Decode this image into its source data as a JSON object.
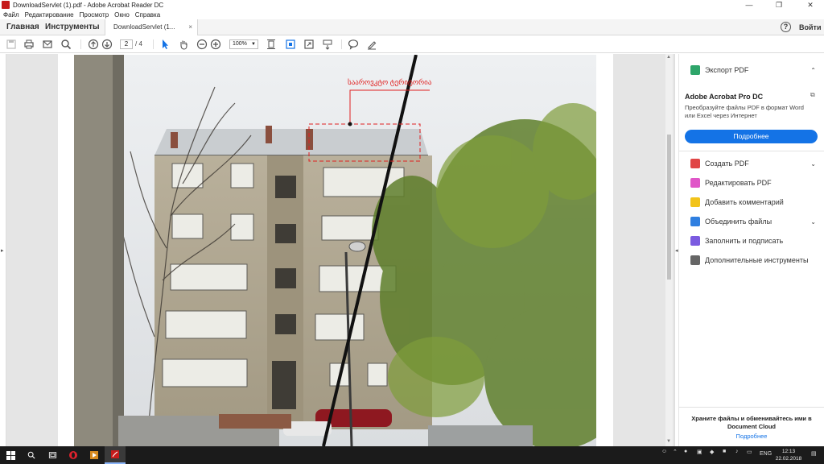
{
  "window": {
    "title": "DownloadServlet (1).pdf - Adobe Acrobat Reader DC",
    "minimize": "—",
    "maximize": "❐",
    "close": "✕"
  },
  "menu": [
    "Файл",
    "Редактирование",
    "Просмотр",
    "Окно",
    "Справка"
  ],
  "tabs": {
    "home": "Главная",
    "tools": "Инструменты",
    "document": "DownloadServlet (1...",
    "close": "×",
    "help": "?",
    "signin": "Войти"
  },
  "toolbar": {
    "page_current": "2",
    "page_total": "/  4",
    "zoom": "100%"
  },
  "document": {
    "annotation_label": "სააროვკტო ტერიტორია"
  },
  "pane": {
    "export_pdf": "Экспорт PDF",
    "promo_title": "Adobe Acrobat Pro DC",
    "promo_text": "Преобразуйте файлы PDF в формат Word или Excel через Интернет",
    "promo_button": "Подробнее",
    "tools": [
      {
        "label": "Создать PDF",
        "color": "#e04545",
        "expand": "⌄"
      },
      {
        "label": "Редактировать PDF",
        "color": "#e056c8",
        "expand": ""
      },
      {
        "label": "Добавить комментарий",
        "color": "#f2c31a",
        "expand": ""
      },
      {
        "label": "Объединить файлы",
        "color": "#2f7fe0",
        "expand": "⌄"
      },
      {
        "label": "Заполнить и подписать",
        "color": "#7b5be0",
        "expand": ""
      },
      {
        "label": "Дополнительные инструменты",
        "color": "#666666",
        "expand": ""
      }
    ],
    "cloud_text": "Храните файлы и обменивайтесь ими в Document Cloud",
    "cloud_link": "Подробнее"
  },
  "taskbar": {
    "lang": "ENG",
    "time": "12:13",
    "date": "22.02.2018"
  },
  "colors": {
    "accent": "#1473e6",
    "annotation": "#e02020"
  }
}
